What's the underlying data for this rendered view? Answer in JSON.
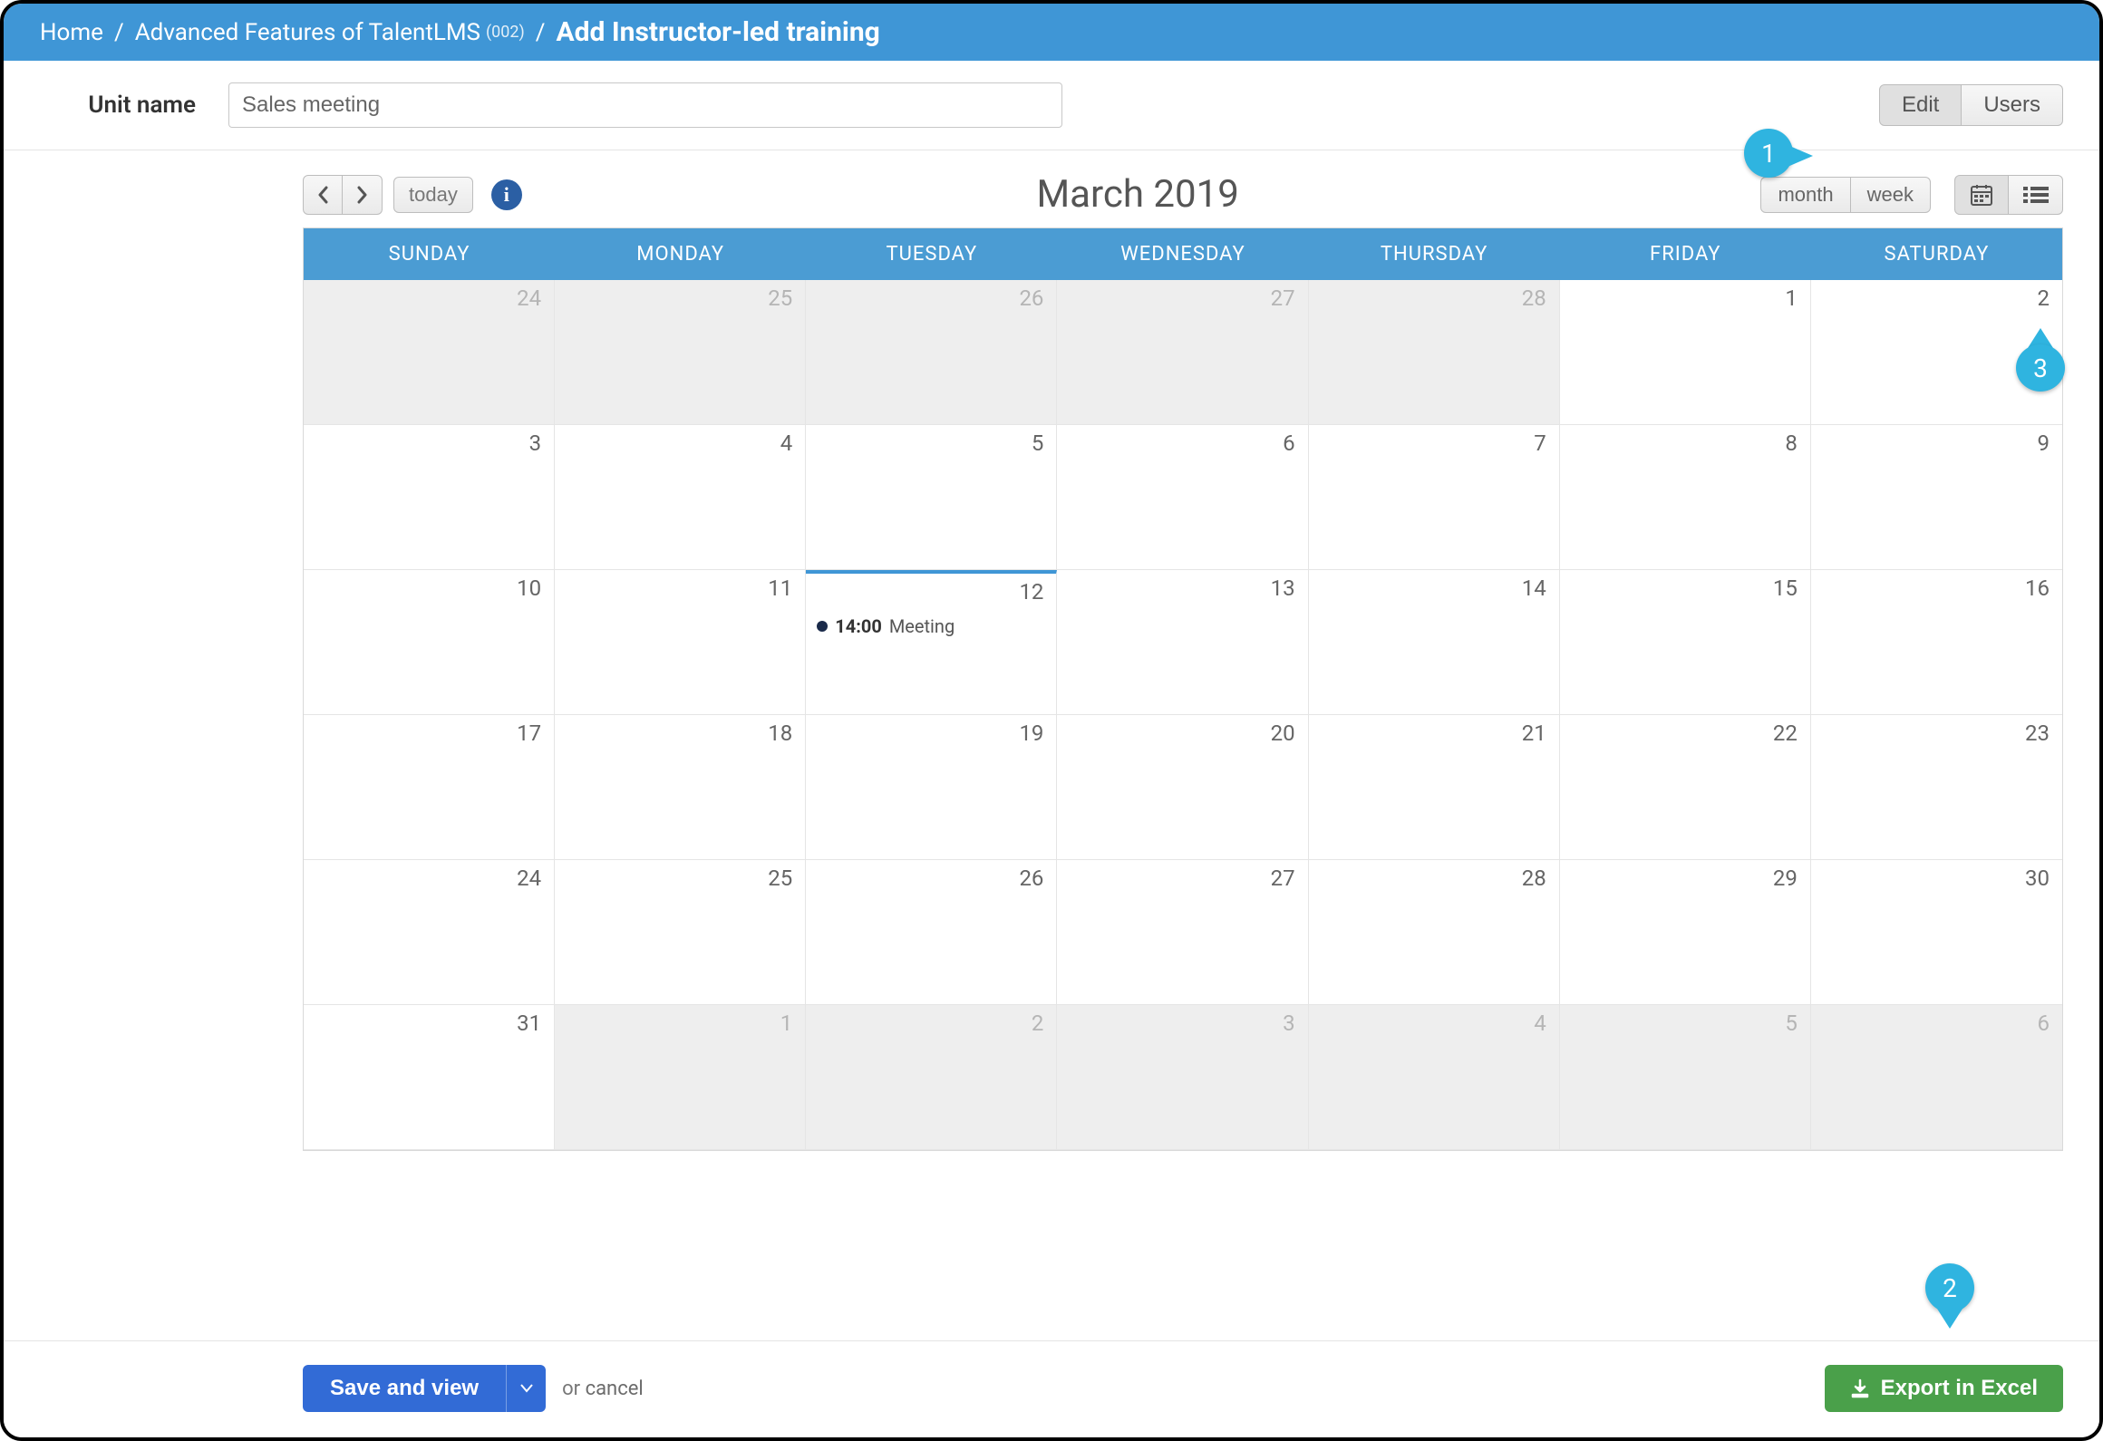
{
  "breadcrumb": {
    "home": "Home",
    "course": "Advanced Features of TalentLMS",
    "code": "(002)",
    "current": "Add Instructor-led training"
  },
  "unit": {
    "label": "Unit name",
    "value": "Sales meeting"
  },
  "tabs": {
    "edit": "Edit",
    "users": "Users"
  },
  "toolbar": {
    "today": "today",
    "title": "March 2019",
    "views": {
      "month": "month",
      "week": "week"
    }
  },
  "days": [
    "SUNDAY",
    "MONDAY",
    "TUESDAY",
    "WEDNESDAY",
    "THURSDAY",
    "FRIDAY",
    "SATURDAY"
  ],
  "weeks": [
    [
      {
        "n": "24",
        "out": true
      },
      {
        "n": "25",
        "out": true
      },
      {
        "n": "26",
        "out": true
      },
      {
        "n": "27",
        "out": true
      },
      {
        "n": "28",
        "out": true
      },
      {
        "n": "1"
      },
      {
        "n": "2"
      }
    ],
    [
      {
        "n": "3"
      },
      {
        "n": "4"
      },
      {
        "n": "5"
      },
      {
        "n": "6"
      },
      {
        "n": "7"
      },
      {
        "n": "8"
      },
      {
        "n": "9"
      }
    ],
    [
      {
        "n": "10"
      },
      {
        "n": "11"
      },
      {
        "n": "12",
        "today": true,
        "event": {
          "time": "14:00",
          "title": "Meeting"
        }
      },
      {
        "n": "13"
      },
      {
        "n": "14"
      },
      {
        "n": "15"
      },
      {
        "n": "16"
      }
    ],
    [
      {
        "n": "17"
      },
      {
        "n": "18"
      },
      {
        "n": "19"
      },
      {
        "n": "20"
      },
      {
        "n": "21"
      },
      {
        "n": "22"
      },
      {
        "n": "23"
      }
    ],
    [
      {
        "n": "24"
      },
      {
        "n": "25"
      },
      {
        "n": "26"
      },
      {
        "n": "27"
      },
      {
        "n": "28"
      },
      {
        "n": "29"
      },
      {
        "n": "30"
      }
    ],
    [
      {
        "n": "31"
      },
      {
        "n": "1",
        "out": true
      },
      {
        "n": "2",
        "out": true
      },
      {
        "n": "3",
        "out": true
      },
      {
        "n": "4",
        "out": true
      },
      {
        "n": "5",
        "out": true
      },
      {
        "n": "6",
        "out": true
      }
    ]
  ],
  "footer": {
    "save": "Save and view",
    "or": "or",
    "cancel": "cancel",
    "export": "Export in Excel"
  },
  "markers": {
    "m1": "1",
    "m2": "2",
    "m3": "3"
  }
}
